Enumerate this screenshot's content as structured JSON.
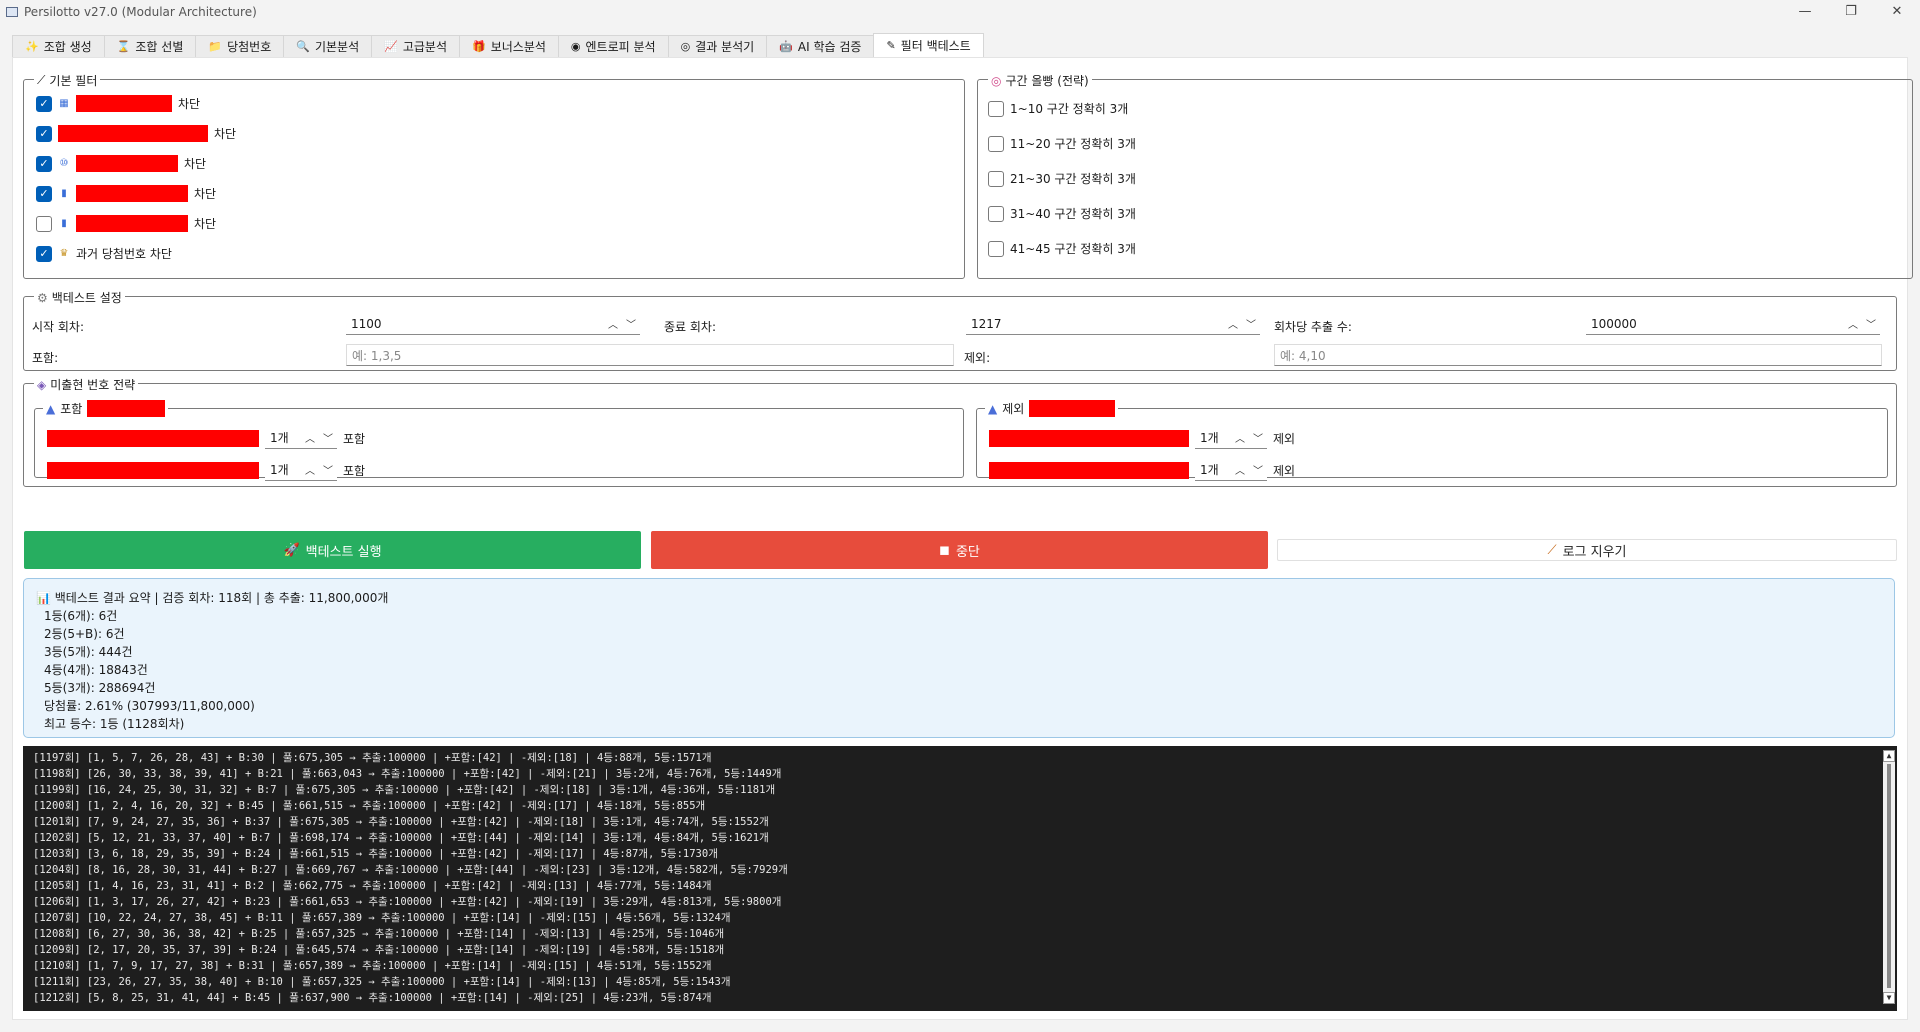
{
  "window": {
    "title": "Persilotto v27.0 (Modular Architecture)",
    "minimize": "—",
    "maximize": "❐",
    "close": "✕"
  },
  "tabs": [
    {
      "icon": "✨",
      "label": "조합 생성"
    },
    {
      "icon": "⌛",
      "label": "조합 선별"
    },
    {
      "icon": "📁",
      "label": "당첨번호"
    },
    {
      "icon": "🔍",
      "label": "기본분석"
    },
    {
      "icon": "📈",
      "label": "고급분석"
    },
    {
      "icon": "🎁",
      "label": "보너스분석"
    },
    {
      "icon": "◉",
      "label": "엔트로피 분석"
    },
    {
      "icon": "◎",
      "label": "결과 분석기"
    },
    {
      "icon": "🤖",
      "label": "AI 학습  검증"
    },
    {
      "icon": "✎",
      "label": "필터 백테스트"
    }
  ],
  "basic_filter": {
    "title": "기본 필터",
    "items": [
      {
        "checked": true,
        "suffix": "차단"
      },
      {
        "checked": true,
        "suffix": "차단"
      },
      {
        "checked": true,
        "suffix": "차단"
      },
      {
        "checked": true,
        "suffix": "차단"
      },
      {
        "checked": false,
        "suffix": "차단"
      },
      {
        "checked": true,
        "suffix": "과거 당첨번호 차단"
      }
    ]
  },
  "zone_filter": {
    "title": "구간 올빵 (전략)",
    "items": [
      {
        "checked": false,
        "label": "1~10 구간 정확히 3개"
      },
      {
        "checked": false,
        "label": "11~20 구간 정확히 3개"
      },
      {
        "checked": false,
        "label": "21~30 구간 정확히 3개"
      },
      {
        "checked": false,
        "label": "31~40 구간 정확히 3개"
      },
      {
        "checked": false,
        "label": "41~45 구간 정확히 3개"
      }
    ]
  },
  "backtest": {
    "title": "백테스트 설정",
    "start_label": "시작 회차:",
    "start_value": "1100",
    "end_label": "종료 회차:",
    "end_value": "1217",
    "per_label": "회차당 추출 수:",
    "per_value": "100000",
    "include_label": "포함:",
    "include_placeholder": "예: 1,3,5",
    "exclude_label": "제외:",
    "exclude_placeholder": "예: 4,10"
  },
  "unseen": {
    "title": "미출현 번호 전략",
    "include_title": "포함",
    "exclude_title": "제외",
    "include_rows": [
      {
        "count": "1개",
        "action": "포함"
      },
      {
        "count": "1개",
        "action": "포함"
      }
    ],
    "exclude_rows": [
      {
        "count": "1개",
        "action": "제외"
      },
      {
        "count": "1개",
        "action": "제외"
      }
    ]
  },
  "buttons": {
    "run": "백테스트 실행",
    "stop": "중단",
    "clear": "로그 지우기"
  },
  "summary": {
    "header": "백테스트 결과 요약  |  검증 회차: 118회  |  총 추출: 11,800,000개",
    "lines": [
      "1등(6개): 6건",
      "2등(5+B): 6건",
      "3등(5개): 444건",
      "4등(4개): 18843건",
      "5등(3개): 288694건",
      "당첨률: 2.61% (307993/11,800,000)",
      "최고 등수: 1등 (1128회차)"
    ]
  },
  "log_lines": [
    "[1197회] [1, 5, 7, 26, 28, 43] + B:30 | 풀:675,305 → 추출:100000 | +포함:[42] | -제외:[18] | 4등:88개, 5등:1571개",
    "[1198회] [26, 30, 33, 38, 39, 41] + B:21 | 풀:663,043 → 추출:100000 | +포함:[42] | -제외:[21] | 3등:2개, 4등:76개, 5등:1449개",
    "[1199회] [16, 24, 25, 30, 31, 32] + B:7 | 풀:675,305 → 추출:100000 | +포함:[42] | -제외:[18] | 3등:1개, 4등:36개, 5등:1181개",
    "[1200회] [1, 2, 4, 16, 20, 32] + B:45 | 풀:661,515 → 추출:100000 | +포함:[42] | -제외:[17] | 4등:18개, 5등:855개",
    "[1201회] [7, 9, 24, 27, 35, 36] + B:37 | 풀:675,305 → 추출:100000 | +포함:[42] | -제외:[18] | 3등:1개, 4등:74개, 5등:1552개",
    "[1202회] [5, 12, 21, 33, 37, 40] + B:7 | 풀:698,174 → 추출:100000 | +포함:[44] | -제외:[14] | 3등:1개, 4등:84개, 5등:1621개",
    "[1203회] [3, 6, 18, 29, 35, 39] + B:24 | 풀:661,515 → 추출:100000 | +포함:[42] | -제외:[17] | 4등:87개, 5등:1730개",
    "[1204회] [8, 16, 28, 30, 31, 44] + B:27 | 풀:669,767 → 추출:100000 | +포함:[44] | -제외:[23] | 3등:12개, 4등:582개, 5등:7929개",
    "[1205회] [1, 4, 16, 23, 31, 41] + B:2 | 풀:662,775 → 추출:100000 | +포함:[42] | -제외:[13] | 4등:77개, 5등:1484개",
    "[1206회] [1, 3, 17, 26, 27, 42] + B:23 | 풀:661,653 → 추출:100000 | +포함:[42] | -제외:[19] | 3등:29개, 4등:813개, 5등:9800개",
    "[1207회] [10, 22, 24, 27, 38, 45] + B:11 | 풀:657,389 → 추출:100000 | +포함:[14] | -제외:[15] | 4등:56개, 5등:1324개",
    "[1208회] [6, 27, 30, 36, 38, 42] + B:25 | 풀:657,325 → 추출:100000 | +포함:[14] | -제외:[13] | 4등:25개, 5등:1046개",
    "[1209회] [2, 17, 20, 35, 37, 39] + B:24 | 풀:645,574 → 추출:100000 | +포함:[14] | -제외:[19] | 4등:58개, 5등:1518개",
    "[1210회] [1, 7, 9, 17, 27, 38] + B:31 | 풀:657,389 → 추출:100000 | +포함:[14] | -제외:[15] | 4등:51개, 5등:1552개",
    "[1211회] [23, 26, 27, 35, 38, 40] + B:10 | 풀:657,325 → 추출:100000 | +포함:[14] | -제외:[13] | 4등:85개, 5등:1543개",
    "[1212회] [5, 8, 25, 31, 41, 44] + B:45 | 풀:637,900 → 추출:100000 | +포함:[14] | -제외:[25] | 4등:23개, 5등:874개"
  ]
}
